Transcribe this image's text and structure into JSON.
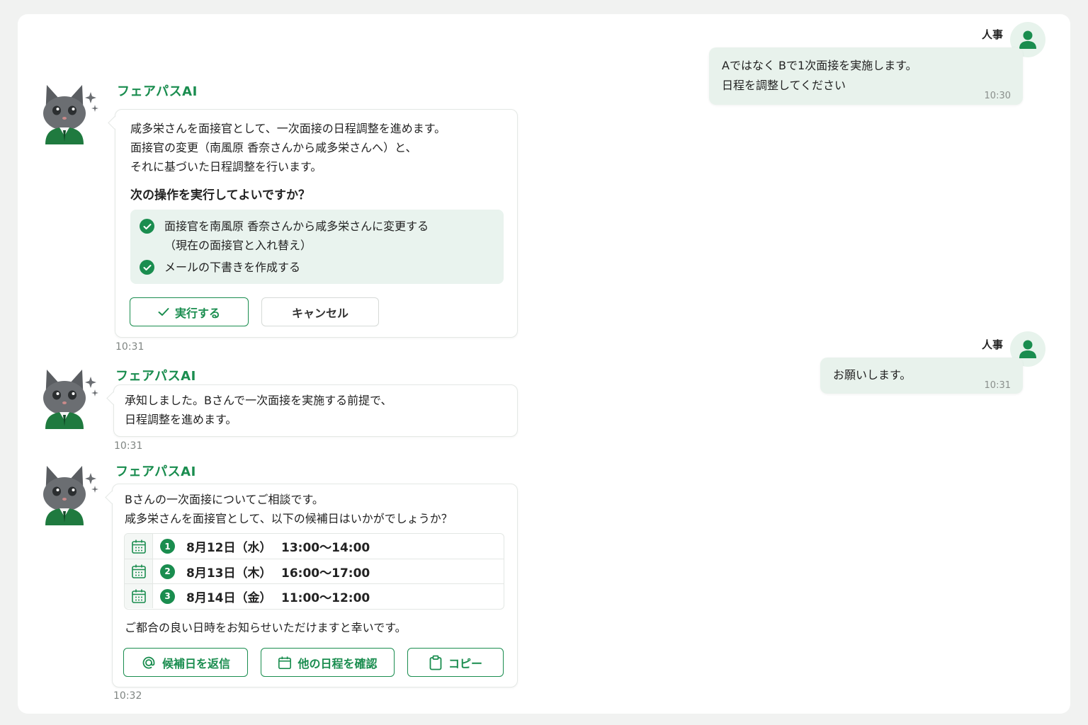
{
  "user": {
    "name": "人事",
    "messages": [
      {
        "lines": "Aではなく Bで1次面接を実施します。\n日程を調整してください",
        "time": "10:30"
      },
      {
        "lines": "お願いします。",
        "time": "10:31"
      }
    ]
  },
  "ai": {
    "name": "フェアパスAI",
    "messages": [
      {
        "text": "咸多栄さんを面接官として、一次面接の日程調整を進めます。\n面接官の変更（南風原 香奈さんから咸多栄さんへ）と、\nそれに基づいた日程調整を行います。",
        "question": "次の操作を実行してよいですか？",
        "operations": [
          "面接官を南風原 香奈さんから咸多栄さんに変更する\n（現在の面接官と入れ替え）",
          "メールの下書きを作成する"
        ],
        "confirm_label": "実行する",
        "cancel_label": "キャンセル",
        "time": "10:31"
      },
      {
        "text": "承知しました。Bさんで一次面接を実施する前提で、\n日程調整を進めます。",
        "time": "10:31"
      },
      {
        "text": "Bさんの一次面接についてご相談です。\n咸多栄さんを面接官として、以下の候補日はいかがでしょうか？",
        "candidates": [
          {
            "num": "1",
            "date": "8月12日（水）",
            "time": "13:00〜14:00"
          },
          {
            "num": "2",
            "date": "8月13日（木）",
            "time": "16:00〜17:00"
          },
          {
            "num": "3",
            "date": "8月14日（金）",
            "time": "11:00〜12:00"
          }
        ],
        "closing": "ご都合の良い日時をお知らせいただけますと幸いです。",
        "actions": [
          "候補日を返信",
          "他の日程を確認",
          "コピー"
        ],
        "time": "10:32"
      }
    ]
  },
  "colors": {
    "accent": "#1a8d4f",
    "user_bubble": "#e8f2ec",
    "op_box": "#e9f3ee"
  },
  "icons": [
    "user-icon",
    "cat-mascot-icon",
    "sparkle-icon",
    "check-circle-icon",
    "check-icon",
    "calendar-icon",
    "at-icon",
    "clipboard-icon"
  ]
}
